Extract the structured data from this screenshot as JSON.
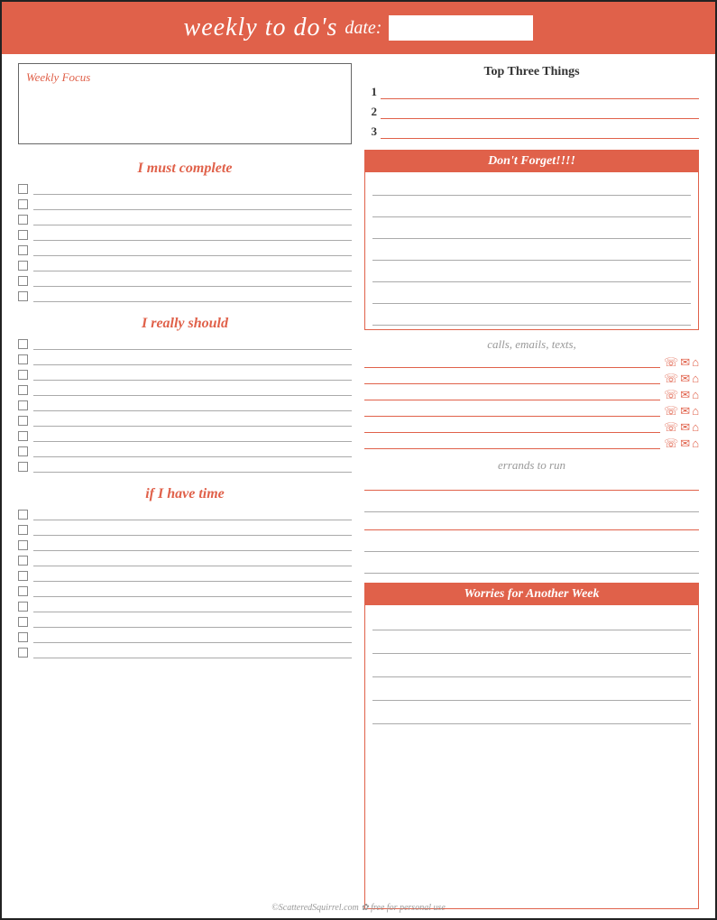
{
  "header": {
    "title": "weekly to do's",
    "date_label": "date:",
    "date_placeholder": ""
  },
  "left": {
    "weekly_focus_label": "Weekly Focus",
    "must_complete_title": "I must complete",
    "really_should_title": "I really should",
    "if_time_title": "if I have time",
    "checklist_count_must": 8,
    "checklist_count_should": 9,
    "checklist_count_time": 10
  },
  "right": {
    "top_three_title": "Top Three Things",
    "dont_forget_title": "Don't Forget!!!!",
    "calls_title": "calls, emails, texts,",
    "calls_rows": 6,
    "errands_title": "errands to run",
    "errands_rows": 5,
    "worries_title": "Worries for Another Week",
    "worries_rows": 5
  },
  "footer": {
    "text": "©ScatteredSquirrel.com  ✿ free for personal use"
  },
  "colors": {
    "accent": "#e0614a",
    "text_dark": "#333",
    "text_light": "#999",
    "line": "#aaa"
  }
}
